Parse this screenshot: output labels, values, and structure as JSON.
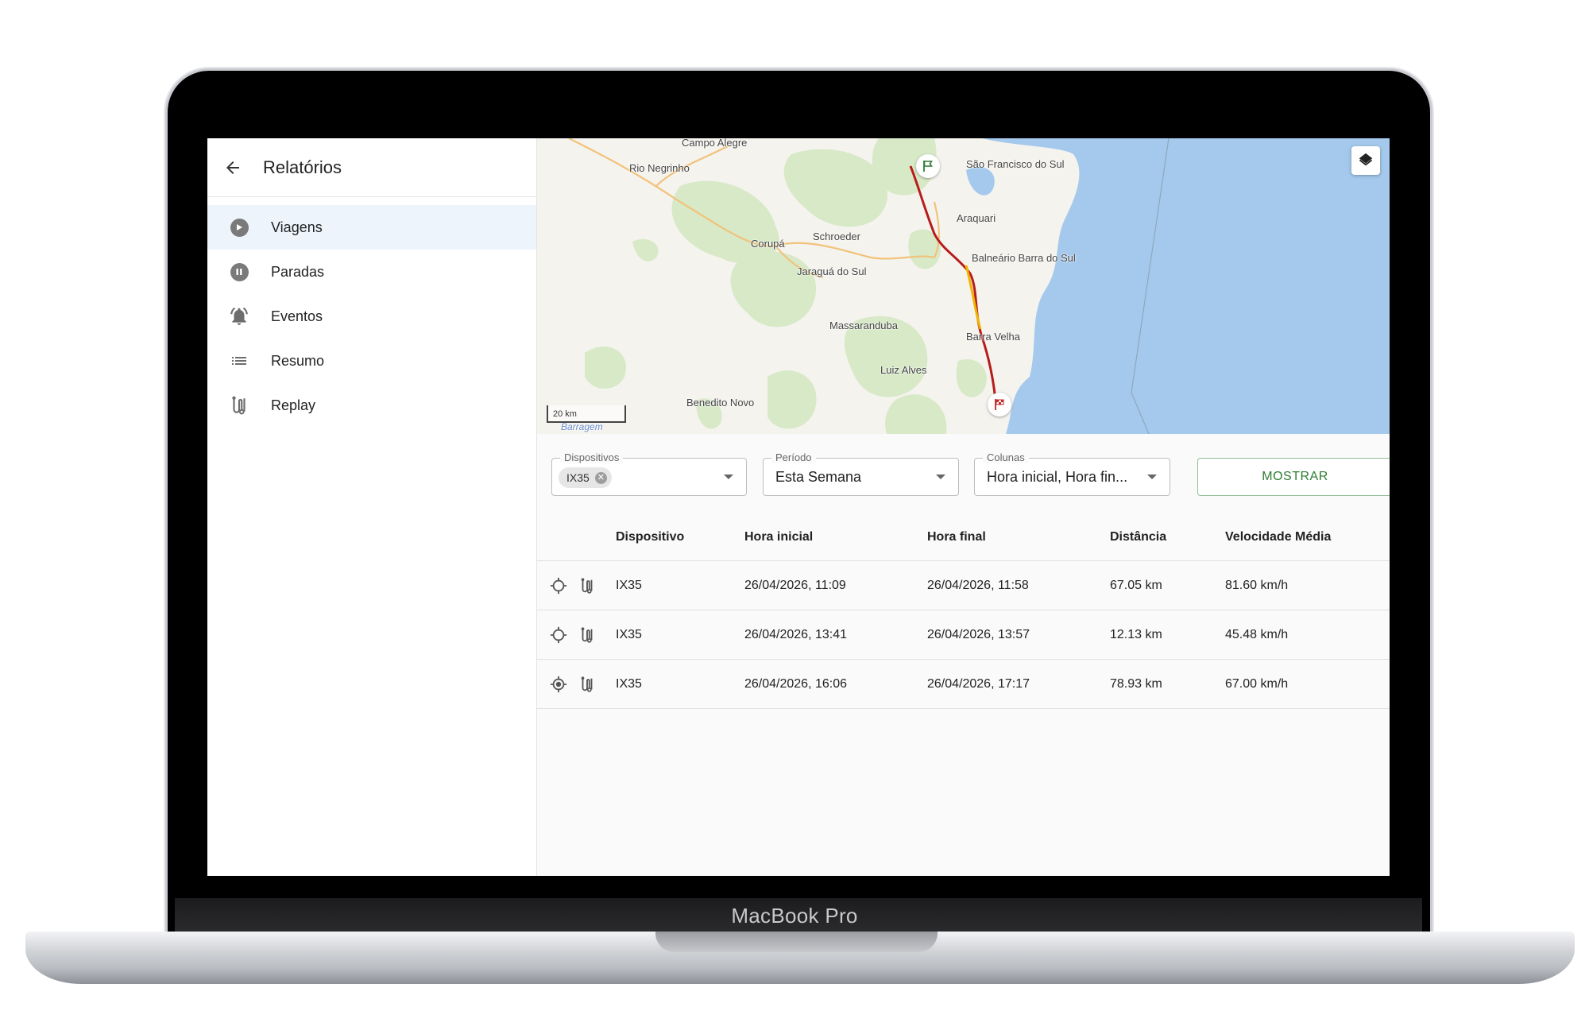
{
  "device_brand": "MacBook Pro",
  "sidebar": {
    "title": "Relatórios",
    "items": [
      {
        "label": "Viagens",
        "icon": "play-circle-icon",
        "active": true
      },
      {
        "label": "Paradas",
        "icon": "pause-circle-icon",
        "active": false
      },
      {
        "label": "Eventos",
        "icon": "bell-alert-icon",
        "active": false
      },
      {
        "label": "Resumo",
        "icon": "list-icon",
        "active": false
      },
      {
        "label": "Replay",
        "icon": "route-icon",
        "active": false
      }
    ]
  },
  "map": {
    "labels": [
      "Campo Alegre",
      "Rio Negrinho",
      "São Francisco do Sul",
      "Araquari",
      "Corupá",
      "Schroeder",
      "Jaraguá do Sul",
      "Balneário Barra do Sul",
      "Massaranduba",
      "Barra Velha",
      "Luiz Alves",
      "Benedito Novo",
      "Barragem"
    ],
    "scale_label": "20 km",
    "colors": {
      "land": "#f5f3ee",
      "forest": "#d7e9c7",
      "water": "#a4c9ec",
      "route": "#b71c1c",
      "road": "#f2c27b"
    }
  },
  "filters": {
    "devices": {
      "label": "Dispositivos",
      "chip": "IX35"
    },
    "period": {
      "label": "Período",
      "value": "Esta Semana"
    },
    "columns": {
      "label": "Colunas",
      "value": "Hora inicial, Hora fin..."
    },
    "show_button": "MOSTRAR"
  },
  "table": {
    "headers": {
      "device": "Dispositivo",
      "start": "Hora inicial",
      "end": "Hora final",
      "distance": "Distância",
      "speed": "Velocidade Média"
    },
    "rows": [
      {
        "device": "IX35",
        "start": "26/04/2026, 11:09",
        "end": "26/04/2026, 11:58",
        "distance": "67.05 km",
        "speed": "81.60 km/h",
        "selected": false
      },
      {
        "device": "IX35",
        "start": "26/04/2026, 13:41",
        "end": "26/04/2026, 13:57",
        "distance": "12.13 km",
        "speed": "45.48 km/h",
        "selected": false
      },
      {
        "device": "IX35",
        "start": "26/04/2026, 16:06",
        "end": "26/04/2026, 17:17",
        "distance": "78.93 km",
        "speed": "67.00 km/h",
        "selected": true
      }
    ]
  },
  "accent_color": "#2e7d32"
}
